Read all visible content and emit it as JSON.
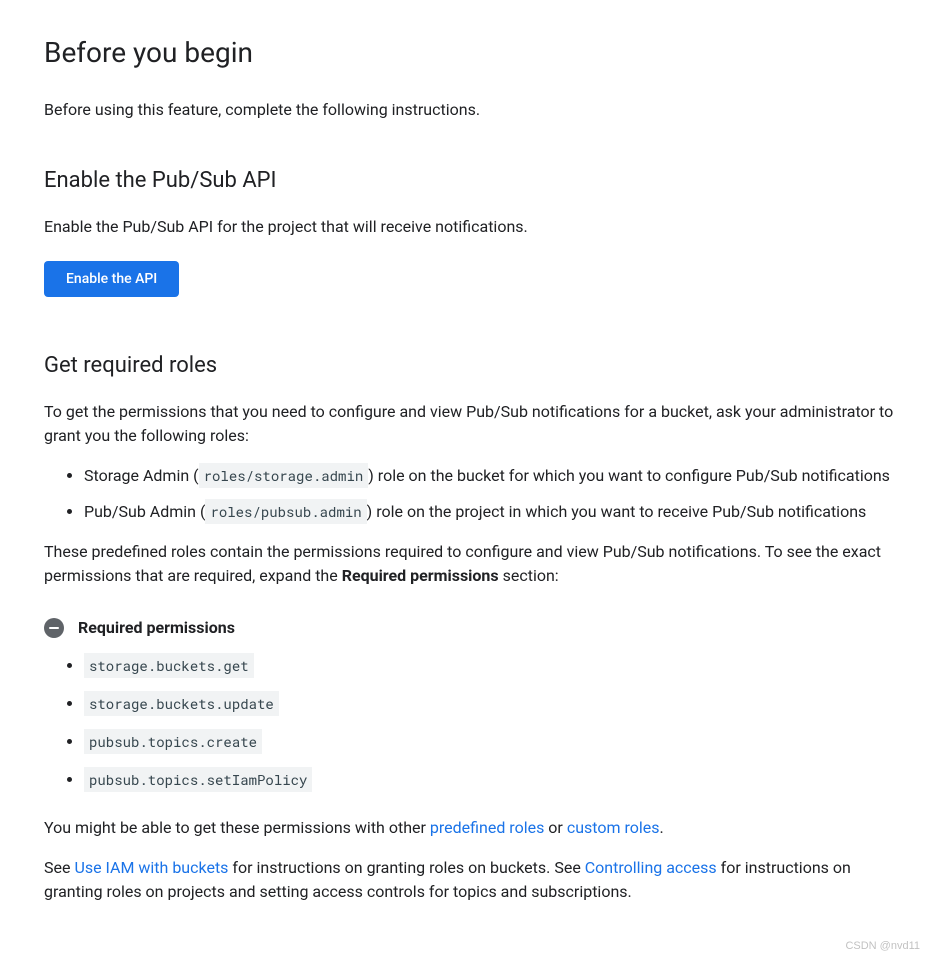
{
  "h1": "Before you begin",
  "intro": "Before using this feature, complete the following instructions.",
  "enable_h2": "Enable the Pub/Sub API",
  "enable_p": "Enable the Pub/Sub API for the project that will receive notifications.",
  "enable_btn": "Enable the API",
  "roles_h2": "Get required roles",
  "roles_intro": "To get the permissions that you need to configure and view Pub/Sub notifications for a bucket, ask your administrator to grant you the following roles:",
  "role1_pre": "Storage Admin (",
  "role1_code": "roles/storage.admin",
  "role1_post": ") role on the bucket for which you want to configure Pub/Sub notifications",
  "role2_pre": "Pub/Sub Admin (",
  "role2_code": "roles/pubsub.admin",
  "role2_post": ") role on the project in which you want to receive Pub/Sub notifications",
  "roles_after_pre": "These predefined roles contain the permissions required to configure and view Pub/Sub notifications. To see the exact permissions that are required, expand the ",
  "roles_after_bold": "Required permissions",
  "roles_after_post": " section:",
  "expander_title": "Required permissions",
  "perms": {
    "p0": "storage.buckets.get",
    "p1": "storage.buckets.update",
    "p2": "pubsub.topics.create",
    "p3": "pubsub.topics.setIamPolicy"
  },
  "might_pre": "You might be able to get these permissions with other ",
  "might_link1": "predefined roles",
  "might_mid": " or ",
  "might_link2": "custom roles",
  "might_post": ".",
  "see_pre": "See ",
  "see_link1": "Use IAM with buckets",
  "see_mid1": " for instructions on granting roles on buckets. See ",
  "see_link2": "Controlling access",
  "see_mid2": " for instructions on granting roles on projects and setting access controls for topics and subscriptions.",
  "watermark": "CSDN @nvd11"
}
